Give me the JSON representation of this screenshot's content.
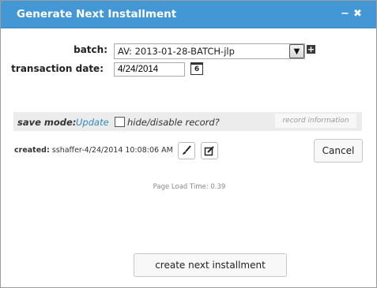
{
  "window": {
    "title": "Generate Next Installment",
    "minimize_glyph": "−",
    "close_glyph": "✖"
  },
  "form": {
    "batch_label": "batch:",
    "batch_value": "AV: 2013-01-28-BATCH-jlp",
    "transaction_date_label": "transaction date:",
    "transaction_date_value": "4/24/2014",
    "calendar_day": "6"
  },
  "save_bar": {
    "save_mode_label": "save mode:",
    "save_mode_value": "Update",
    "hide_disable_label": "hide/disable record?",
    "record_information_label": "record information"
  },
  "footer": {
    "created_label": "created:",
    "created_value": "sshaffer-4/24/2014 10:08:06 AM",
    "cancel_label": "Cancel",
    "page_load_text": "Page Load Time: 0.39",
    "create_button_label": "create next installment"
  },
  "colors": {
    "titlebar": "#4397d4",
    "link": "#2a8abf"
  }
}
